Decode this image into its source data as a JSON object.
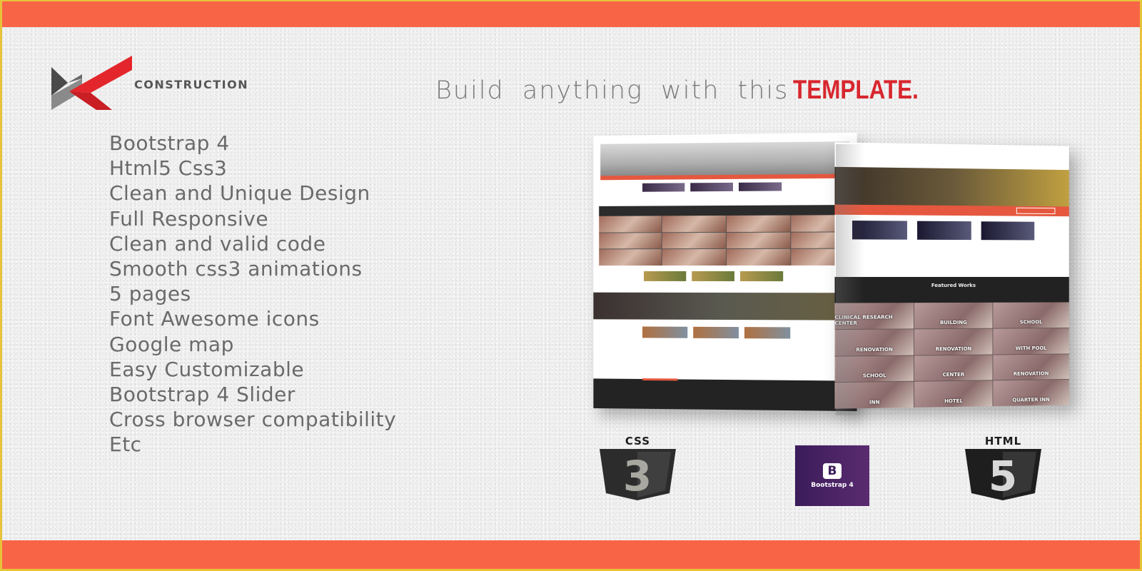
{
  "brand": {
    "name": "CONSTRUCTION",
    "logo_colors": {
      "dark": "#4a4a4a",
      "gray": "#8a8a8a",
      "red": "#e3262b"
    }
  },
  "headline": {
    "lead": "Build anything with this",
    "emphasis": "TEMPLATE."
  },
  "features": [
    "Bootstrap 4",
    "Html5 Css3",
    "Clean and Unique Design",
    "Full Responsive",
    "Clean and valid code",
    "Smooth css3 animations",
    "5 pages",
    "Font Awesome icons",
    "Google map",
    "Easy Customizable",
    "Bootstrap 4 Slider",
    "Cross browser compatibility",
    "Etc"
  ],
  "mockups": {
    "right": {
      "section_title": "Featured Works",
      "tiles": [
        "CLINICAL RESEARCH CENTER",
        "BUILDING",
        "SCHOOL",
        "RENOVATION",
        "RENOVATION",
        "WITH POOL",
        "SCHOOL",
        "CENTER",
        "RENOVATION",
        "INN",
        "HOTEL",
        "QUARTER INN"
      ]
    }
  },
  "badges": {
    "css": {
      "title": "CSS",
      "number": "3"
    },
    "bootstrap": {
      "letter": "B",
      "label": "Bootstrap 4"
    },
    "html": {
      "title": "HTML",
      "number": "5"
    }
  },
  "colors": {
    "band": "#f76546",
    "border": "#e8c23a",
    "accent_red": "#d8262e",
    "text": "#6a6a6a",
    "bootstrap_purple": "#4a2466"
  }
}
